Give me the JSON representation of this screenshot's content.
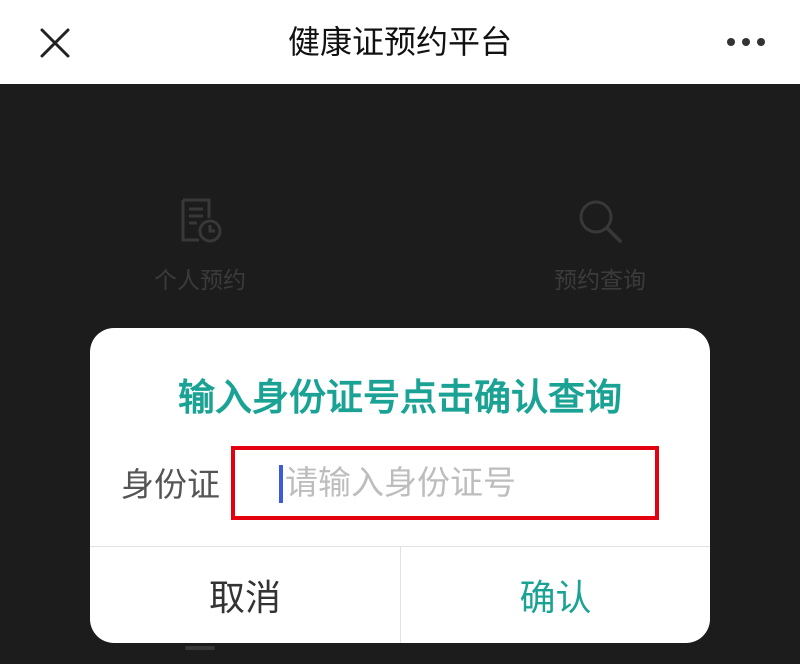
{
  "header": {
    "title": "健康证预约平台",
    "close_icon": "close-icon",
    "more_icon": "more-icon"
  },
  "menu": {
    "items": [
      {
        "label": "个人预约",
        "icon": "document-clock-icon"
      },
      {
        "label": "预约查询",
        "icon": "search-icon"
      }
    ]
  },
  "dialog": {
    "title": "输入身份证号点击确认查询",
    "field_label": "身份证",
    "input_placeholder": "请输入身份证号",
    "cancel_label": "取消",
    "confirm_label": "确认"
  },
  "colors": {
    "accent": "#1aa394",
    "highlight": "#e3000f",
    "cursor": "#3b5bdb",
    "overlay": "#1c1c1c"
  }
}
